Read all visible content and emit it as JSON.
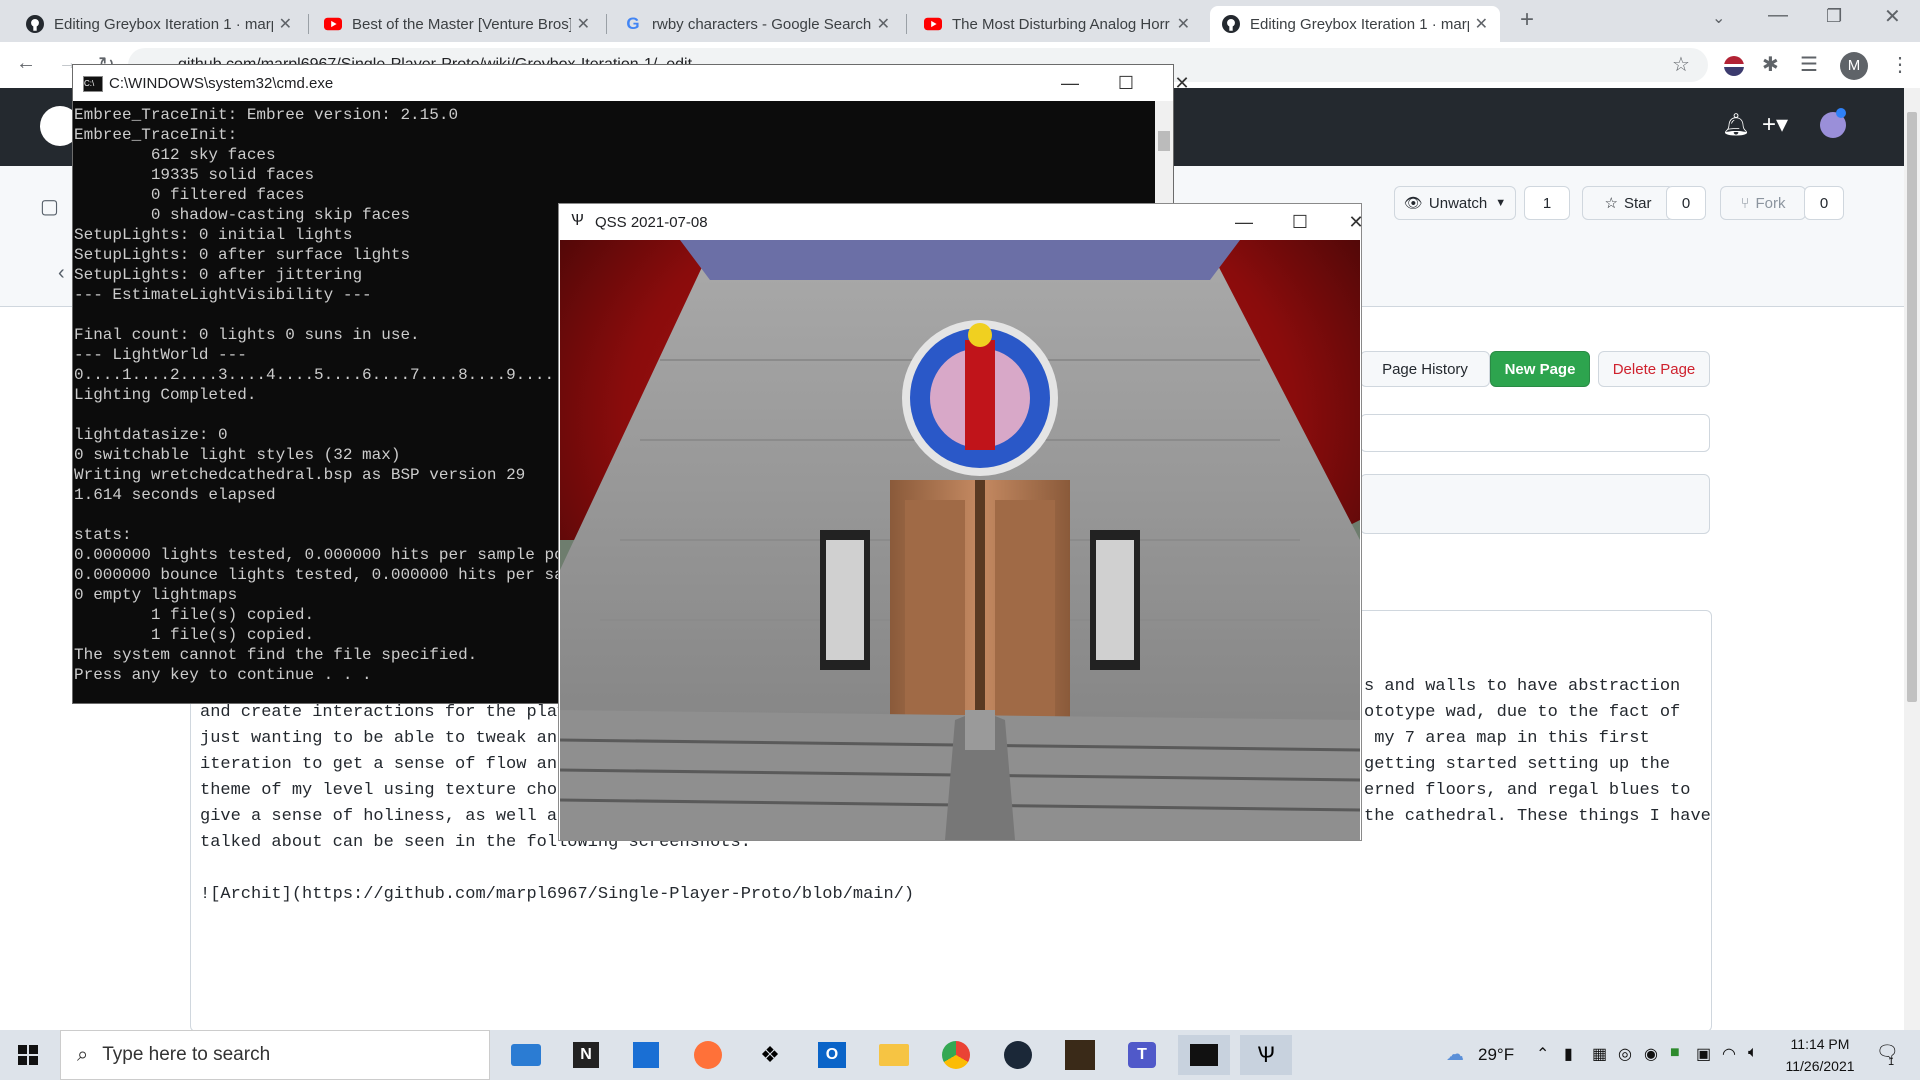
{
  "browser": {
    "tabs": [
      {
        "title": "Editing Greybox Iteration 1 · marp",
        "icon": "github-icon",
        "active": false
      },
      {
        "title": "Best of the Master [Venture Bros]",
        "icon": "youtube-icon",
        "active": false
      },
      {
        "title": "rwby characters - Google Search",
        "icon": "google-icon",
        "active": false
      },
      {
        "title": "The Most Disturbing Analog Horr",
        "icon": "youtube-icon",
        "active": false
      },
      {
        "title": "Editing Greybox Iteration 1 · marp",
        "icon": "github-icon",
        "active": true
      }
    ],
    "new_tab": "+",
    "url": "github.com/marpl6967/Single-Player-Proto/wiki/Greybox-Iteration-1/_edit",
    "profile_initial": "M"
  },
  "github": {
    "unwatch_label": "Unwatch",
    "watch_count": "1",
    "star_label": "Star",
    "star_count": "0",
    "fork_label": "Fork",
    "fork_count": "0",
    "page_history": "Page History",
    "new_page": "New Page",
    "delete_page": "Delete Page",
    "editor_lines_left": [
      "and create interactions for the playe",
      "just wanting to be able to tweak and",
      "iteration to get a sense of flow and",
      "theme of my level using texture choic",
      "give a sense of holiness, as well as",
      "talked about can be seen in the following screenshots:"
    ],
    "editor_lines_right": [
      "s and walls to have abstraction",
      "ototype wad, due to the fact of",
      " my 7 area map in this first",
      "getting started setting up the",
      "erned floors, and regal blues to",
      "the cathedral. These things I have"
    ],
    "editor_link_line": "![Archit](https://github.com/marpl6967/Single-Player-Proto/blob/main/)"
  },
  "cmd": {
    "title": "C:\\WINDOWS\\system32\\cmd.exe",
    "lines": [
      "Embree_TraceInit: Embree version: 2.15.0",
      "Embree_TraceInit:",
      "        612 sky faces",
      "        19335 solid faces",
      "        0 filtered faces",
      "        0 shadow-casting skip faces",
      "SetupLights: 0 initial lights",
      "SetupLights: 0 after surface lights",
      "SetupLights: 0 after jittering",
      "--- EstimateLightVisibility ---",
      "",
      "Final count: 0 lights 0 suns in use.",
      "--- LightWorld ---",
      "0....1....2....3....4....5....6....7....8....9....",
      "Lighting Completed.",
      "",
      "lightdatasize: 0",
      "0 switchable light styles (32 max)",
      "Writing wretchedcathedral.bsp as BSP version 29",
      "1.614 seconds elapsed",
      "",
      "stats:",
      "0.000000 lights tested, 0.000000 hits per sample point",
      "0.000000 bounce lights tested, 0.000000 hits per sampl",
      "0 empty lightmaps",
      "        1 file(s) copied.",
      "        1 file(s) copied.",
      "The system cannot find the file specified.",
      "Press any key to continue . . ."
    ]
  },
  "qss": {
    "title": "QSS 2021-07-08"
  },
  "taskbar": {
    "search_placeholder": "Type here to search",
    "weather": "29°F",
    "time": "11:14 PM",
    "date": "11/26/2021",
    "notifications": "1"
  },
  "colors": {
    "github_green": "#2da44e",
    "github_dark": "#24292f",
    "delete_red": "#cf222e"
  }
}
